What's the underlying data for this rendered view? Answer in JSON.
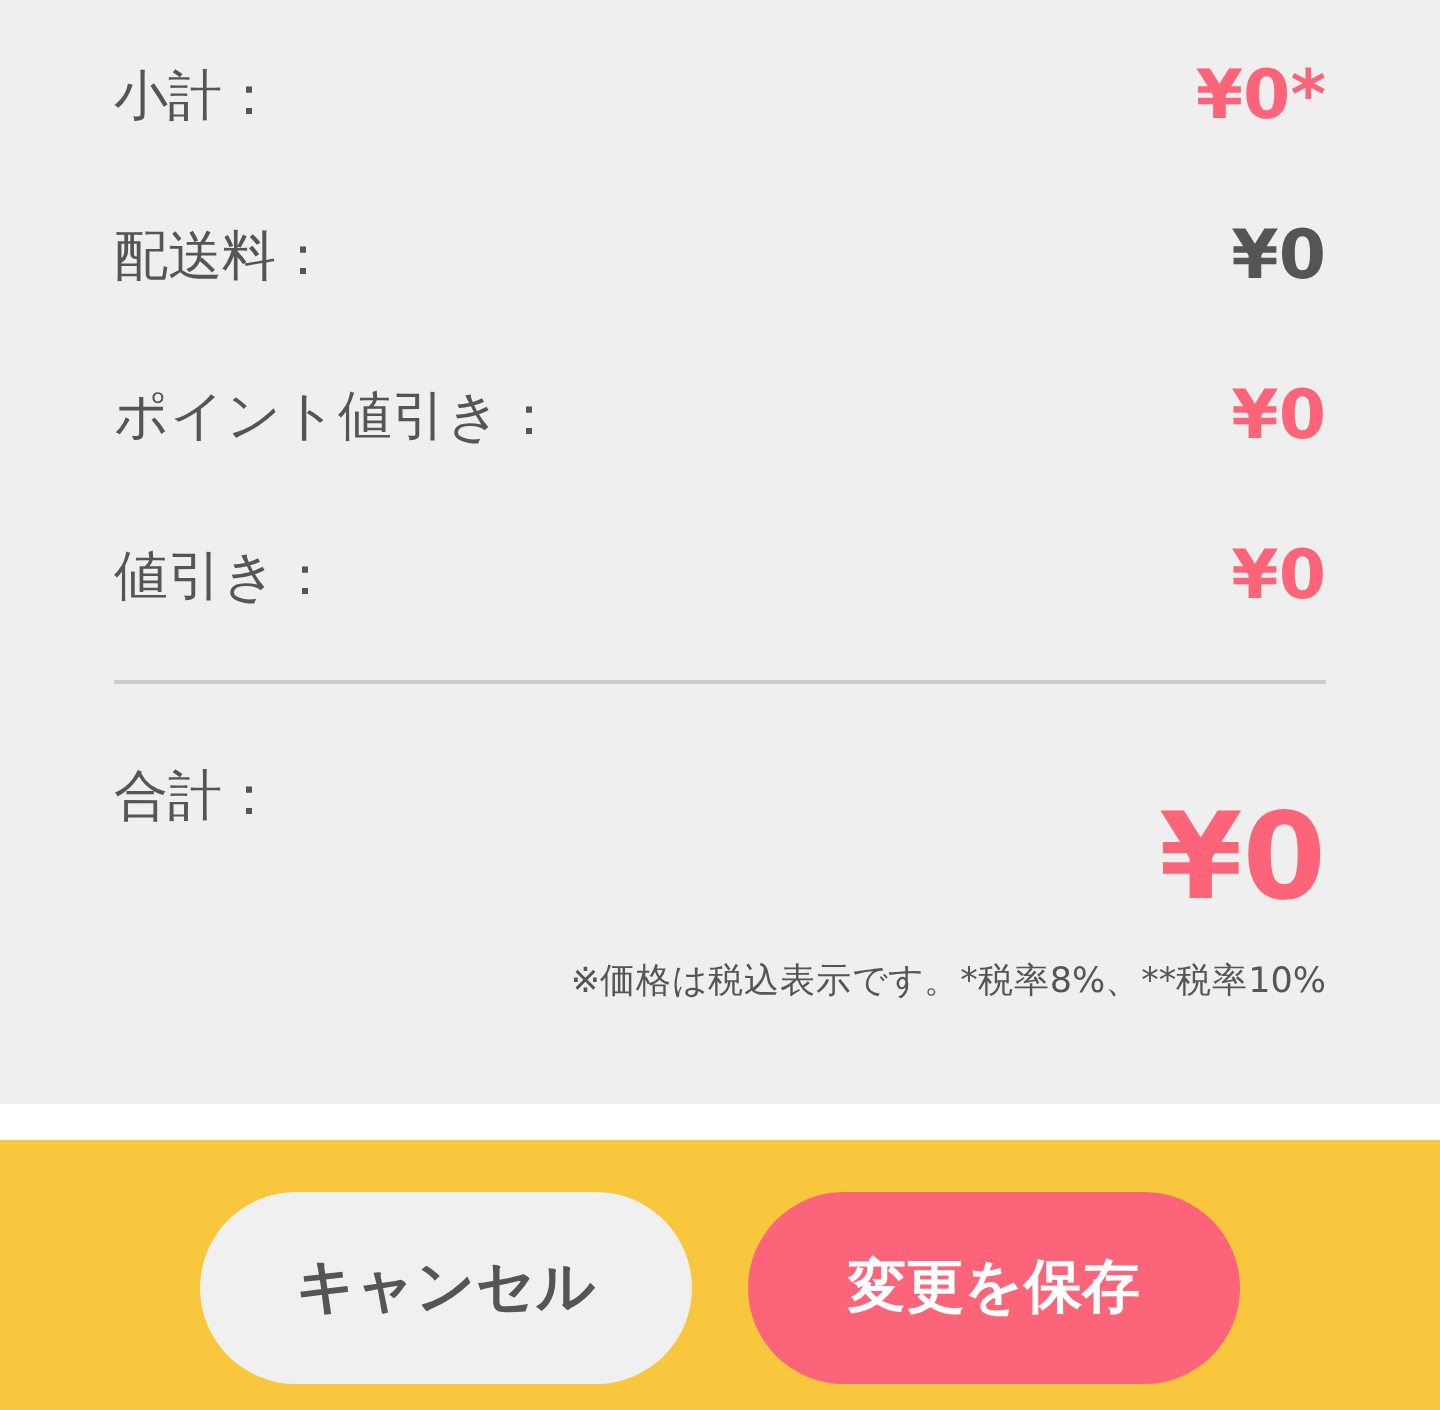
{
  "rows": [
    {
      "label": "小計：",
      "value": "¥0*",
      "color": "#fc6479"
    },
    {
      "label": "配送料：",
      "value": "¥0",
      "color": "#555555"
    },
    {
      "label": "ポイント値引き：",
      "value": "¥0",
      "color": "#fc6479"
    },
    {
      "label": "値引き：",
      "value": "¥0",
      "color": "#fc6479"
    }
  ],
  "total": {
    "label": "合計：",
    "value": "¥0"
  },
  "note": "※価格は税込表示です。*税率8%、**税率10%",
  "buttons": [
    {
      "label": "キャンセル",
      "kind": "secondary"
    },
    {
      "label": "変更を保存",
      "kind": "primary"
    }
  ]
}
